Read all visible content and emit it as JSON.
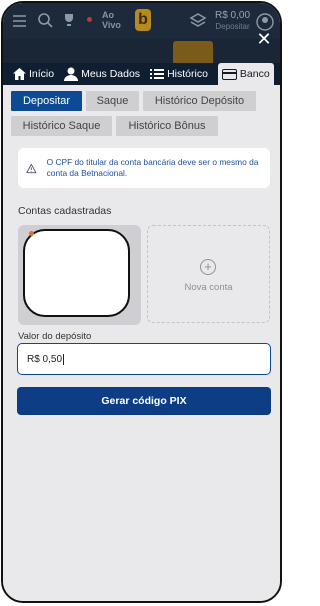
{
  "header": {
    "aovivo": "Ao Vivo",
    "logo_letter": "b",
    "saldo": "R$ 0,00",
    "depositar": "Depositar"
  },
  "tabs": [
    {
      "label": "Início",
      "icon": "home-icon"
    },
    {
      "label": "Meus Dados",
      "icon": "user-icon"
    },
    {
      "label": "Histórico",
      "icon": "list-icon"
    },
    {
      "label": "Banco",
      "icon": "bank-card-icon"
    }
  ],
  "subtabs": [
    {
      "label": "Depositar"
    },
    {
      "label": "Saque"
    },
    {
      "label": "Histórico Depósito"
    },
    {
      "label": "Histórico Saque"
    },
    {
      "label": "Histórico Bônus"
    }
  ],
  "info": {
    "text": "O CPF do titular da conta bancária deve ser o mesmo da conta da Betnacional."
  },
  "contas": {
    "title": "Contas cadastradas",
    "nova_conta": "Nova conta"
  },
  "deposit": {
    "label": "Valor do depósito",
    "value": "R$ 0,50",
    "button": "Gerar código PIX"
  },
  "colors": {
    "primary": "#0d4a94",
    "header_bg": "#0f1e31",
    "info_text": "#1e4f9c"
  }
}
